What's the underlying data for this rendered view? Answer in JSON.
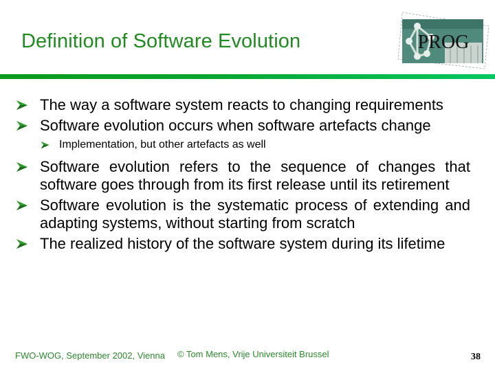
{
  "slide": {
    "title": "Definition of Software Evolution",
    "logo_text": "PROG",
    "accent_color": "#1e8c1e",
    "bullets": [
      {
        "text": "The way a software system reacts to changing requirements",
        "level": 1
      },
      {
        "text": "Software evolution occurs when software artefacts change",
        "level": 1
      },
      {
        "text": "Implementation, but other artefacts as well",
        "level": 2
      },
      {
        "text": "Software evolution refers to the sequence of changes that software goes through from its first release until its retirement",
        "level": 1
      },
      {
        "text": "Software evolution is the systematic process of extending and adapting systems, without starting from scratch",
        "level": 1
      },
      {
        "text": "The realized history of the software system during its lifetime",
        "level": 1
      }
    ],
    "footer": {
      "left": "FWO-WOG, September 2002, Vienna",
      "center": "© Tom Mens, Vrije Universiteit Brussel",
      "slide_number": "38"
    }
  }
}
